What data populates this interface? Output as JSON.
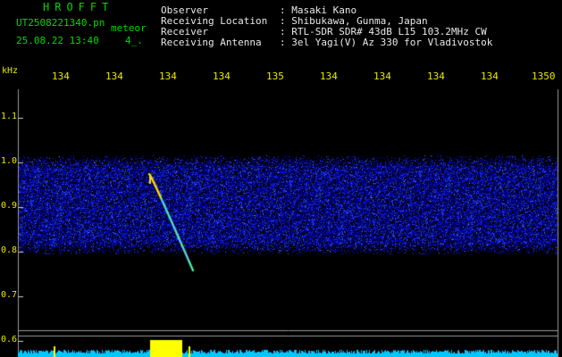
{
  "header": {
    "brand": "HROFFT",
    "filename": "UT2508221340.pn",
    "type": "meteor",
    "datetime": "25.08.22 13:40",
    "count": "4_.",
    "fields": [
      {
        "label": "Observer",
        "value": ": Masaki Kano"
      },
      {
        "label": "Receiving Location",
        "value": ": Shibukawa, Gunma, Japan"
      },
      {
        "label": "Receiver",
        "value": ": RTL-SDR SDR# 43dB L15 103.2MHz CW"
      },
      {
        "label": "Receiving Antenna",
        "value": ": 3el Yagi(V) Az 330 for Vladivostok"
      }
    ]
  },
  "axis": {
    "y_unit": "kHz",
    "x_ticks": [
      "134",
      "134",
      "134",
      "134",
      "135",
      "134",
      "134",
      "134",
      "134",
      "1350"
    ],
    "y_ticks": [
      "1.1",
      "1.0",
      "0.9",
      "0.8",
      "0.7",
      "0.6"
    ]
  },
  "colors": {
    "text": "#00d800",
    "noise_low": "#0000b0",
    "noise_high": "#3c6cff",
    "echo": "#ffd800",
    "strip": "#00c8ff",
    "marker": "#ffff00"
  }
}
